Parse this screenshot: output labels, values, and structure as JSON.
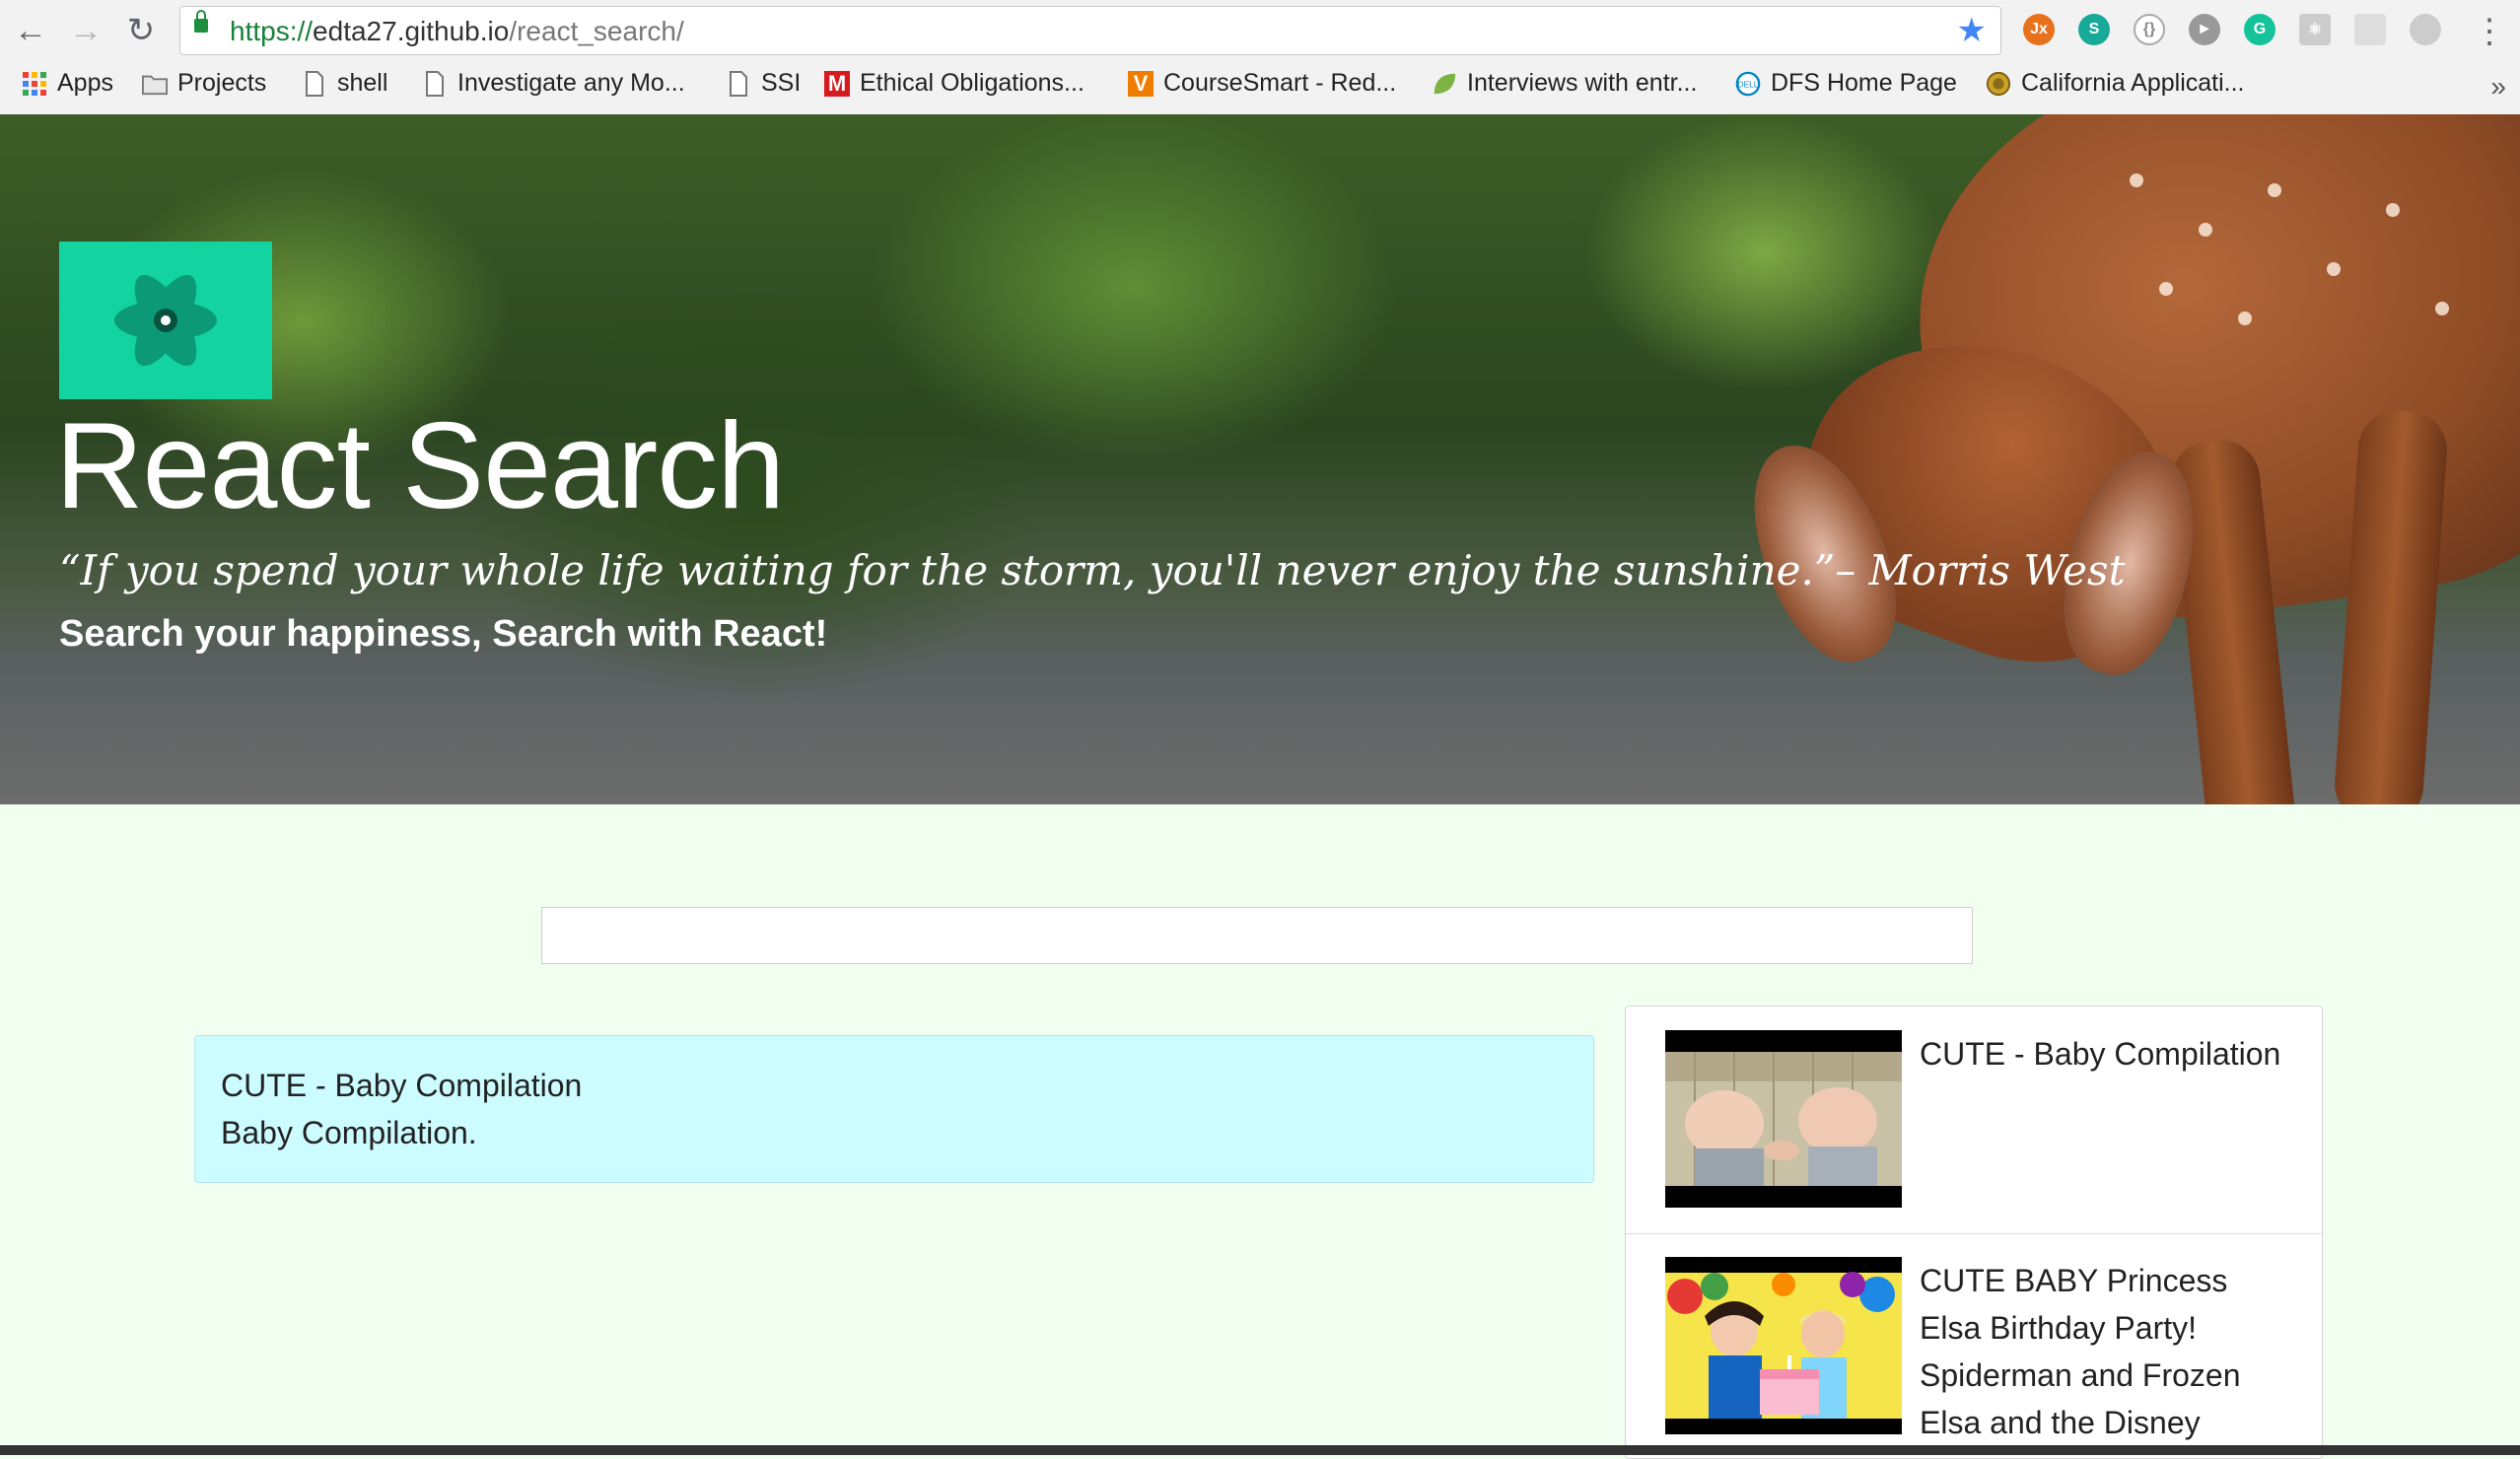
{
  "browser": {
    "url_scheme": "https://",
    "url_host": "edta27.github.io",
    "url_path": "/react_search/",
    "bookmarks": [
      {
        "label": "Apps",
        "icon": "apps-grid-icon"
      },
      {
        "label": "Projects",
        "icon": "folder-icon"
      },
      {
        "label": "shell",
        "icon": "page-icon"
      },
      {
        "label": "Investigate any Mo...",
        "icon": "page-icon"
      },
      {
        "label": "SSI",
        "icon": "page-icon"
      },
      {
        "label": "Ethical Obligations...",
        "icon": "m-logo-icon"
      },
      {
        "label": "CourseSmart - Red...",
        "icon": "v-logo-icon"
      },
      {
        "label": "Interviews with entr...",
        "icon": "leaf-icon"
      },
      {
        "label": "DFS Home Page",
        "icon": "dell-logo-icon"
      },
      {
        "label": "California Applicati...",
        "icon": "seal-icon"
      }
    ],
    "more_label": "»"
  },
  "hero": {
    "title": "React Search",
    "quote": "“If you spend your whole life waiting for the storm, you'll never enjoy the sunshine.”– Morris West",
    "tagline": "Search your happiness, Search with React!"
  },
  "search": {
    "value": "",
    "placeholder": ""
  },
  "selected": {
    "title": "CUTE - Baby Compilation",
    "description": "Baby Compilation."
  },
  "results": [
    {
      "title": "CUTE - Baby Compilation",
      "thumbnail": "babies-thumbnail"
    },
    {
      "title": "CUTE BABY Princess Elsa Birthday Party! Spiderman and Frozen Elsa and the Disney",
      "thumbnail": "party-thumbnail"
    }
  ],
  "colors": {
    "accent": "#13d4a0",
    "page_background": "#f1fff1",
    "selected_card": "#ccfcff"
  }
}
